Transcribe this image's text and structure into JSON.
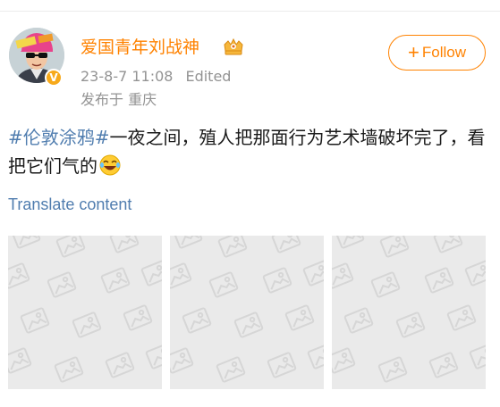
{
  "user": {
    "name": "爱国青年刘战神",
    "verified_badge": "V",
    "avatar": "avatar-cartoon-sunglasses-pink-hat",
    "crown_icon": "crown-badge-icon"
  },
  "meta": {
    "timestamp": "23-8-7 11:08",
    "edited_label": "Edited",
    "location": "发布于 重庆"
  },
  "follow_button": {
    "plus": "+",
    "label": "Follow"
  },
  "post": {
    "topic": "#伦敦涂鸦#",
    "text": "一夜之间，殖人把那面行为艺术墙破坏完了，看把它们气的",
    "emoji": "laughing-tears-emoji"
  },
  "translate_link": "Translate content",
  "photos": [
    "image-placeholder",
    "image-placeholder",
    "image-placeholder"
  ],
  "colors": {
    "accent": "#ff8200",
    "link": "#507daf",
    "meta": "#939393",
    "placeholder_bg": "#eaeaea"
  }
}
